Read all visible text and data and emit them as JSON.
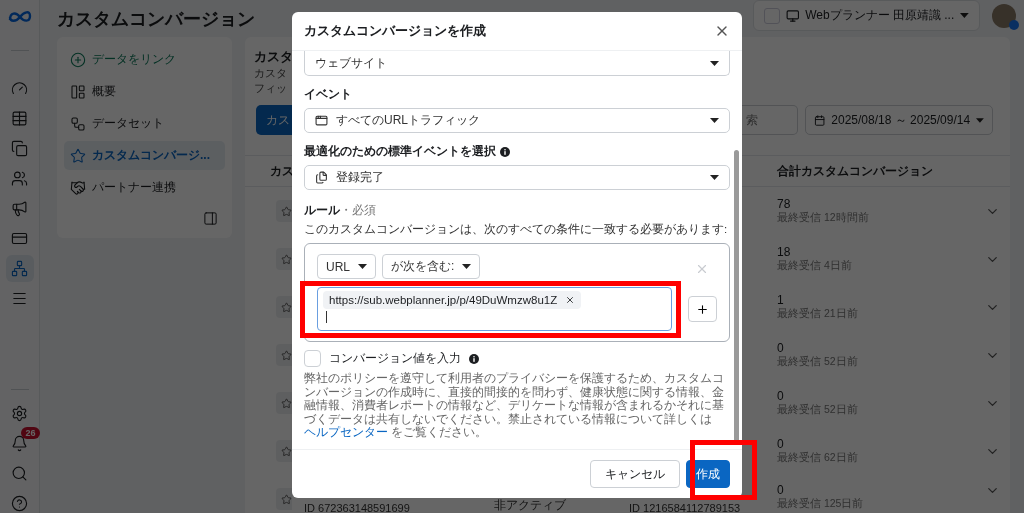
{
  "header": {
    "title": "カスタムコンバージョン",
    "account": "Webプランナー 田原靖識 ..."
  },
  "rail": {
    "items": [
      {
        "selected": false
      },
      {
        "selected": false
      },
      {
        "selected": false
      },
      {
        "selected": false
      },
      {
        "selected": false
      },
      {
        "selected": false
      },
      {
        "selected": true
      },
      {
        "selected": false
      }
    ],
    "badge": "26"
  },
  "nav": [
    {
      "label": "データをリンク",
      "kind": "link",
      "selected": false
    },
    {
      "label": "概要",
      "kind": "item",
      "selected": false
    },
    {
      "label": "データセット",
      "kind": "item",
      "selected": false
    },
    {
      "label": "カスタムコンバージ...",
      "kind": "item",
      "selected": true
    },
    {
      "label": "パートナー連携",
      "kind": "item",
      "selected": false
    }
  ],
  "main": {
    "title": "カスタ",
    "description": [
      "カスタ",
      "フィッ"
    ],
    "create_button": "カス",
    "search_fragment": "索",
    "date_range": "2025/08/18 ～ 2025/09/14",
    "columns": [
      "カス",
      "合計カスタムコンバージョン"
    ],
    "rows": [
      {
        "count": "78",
        "last_received": "最終受信 12時間前"
      },
      {
        "count": "18",
        "last_received": "最終受信 4日前"
      },
      {
        "count": "1",
        "last_received": "最終受信 21日前"
      },
      {
        "count": "0",
        "last_received": "最終受信 52日前"
      },
      {
        "count": "0",
        "last_received": "最終受信 52日前"
      },
      {
        "count": "0",
        "last_received": "最終受信 62日前"
      },
      {
        "count": "0",
        "last_received": "最終受信 125日前",
        "id": "ID 672363148591699",
        "status": "非アクティブ",
        "source_id": "ID 1216584112789153"
      }
    ]
  },
  "dialog": {
    "title": "カスタムコンバージョンを作成",
    "source_value": "ウェブサイト",
    "event_label": "イベント",
    "event_value": "すべてのURLトラフィック",
    "standard_label": "最適化のための標準イベントを選択",
    "standard_value": "登録完了",
    "rule_label": "ルール",
    "rule_required": "・必須",
    "rule_description": "このカスタムコンバージョンは、次のすべての条件に一致する必要があります:",
    "rule_field": "URL",
    "rule_operator": "が次を含む:",
    "rule_value": "https://sub.webplanner.jp/p/49DuWmzw8u1Z",
    "value_checkbox": {
      "label": "コンバージョン値を入力",
      "checked": false
    },
    "policy": "弊社のポリシーを遵守して利用者のプライバシーを保護するため、カスタムコンバージョンの作成時に、直接的間接的を問わず、健康状態に関する情報、金融情報、消費者レポートの情報など、デリケートな情報が含まれるかそれに基づくデータは共有しないでください。禁止されている情報について詳しくは",
    "policy_link": "ヘルプセンター",
    "policy_end": " をご覧ください。",
    "cancel": "キャンセル",
    "create": "作成"
  }
}
